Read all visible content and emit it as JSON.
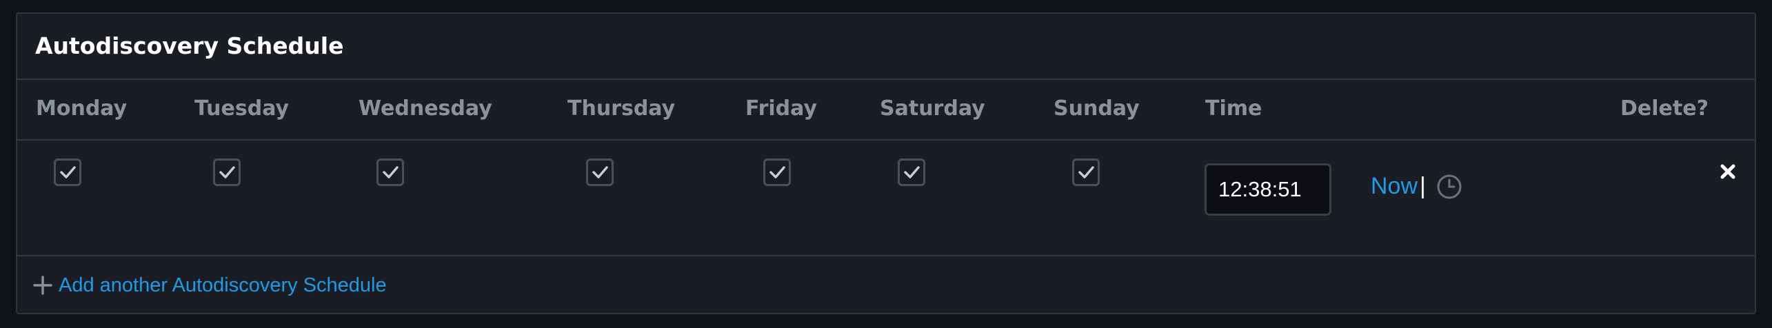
{
  "panel": {
    "title": "Autodiscovery Schedule"
  },
  "columns": {
    "monday": "Monday",
    "tuesday": "Tuesday",
    "wednesday": "Wednesday",
    "thursday": "Thursday",
    "friday": "Friday",
    "saturday": "Saturday",
    "sunday": "Sunday",
    "time": "Time",
    "delete": "Delete?"
  },
  "schedule_row": {
    "days_checked": {
      "monday": true,
      "tuesday": true,
      "wednesday": true,
      "thursday": true,
      "friday": true,
      "saturday": true,
      "sunday": true
    },
    "time_value": "12:38:51",
    "now_label": "Now",
    "separator": "|",
    "clock_icon": "clock-icon",
    "delete_icon": "close-icon"
  },
  "add_link": {
    "label": "Add another Autodiscovery Schedule",
    "icon": "plus-icon"
  },
  "colors": {
    "background": "#0f1217",
    "panel": "#1a1e24",
    "border": "#2f353d",
    "header_text": "#8a939c",
    "link": "#1e9be8",
    "title": "#ffffff"
  }
}
